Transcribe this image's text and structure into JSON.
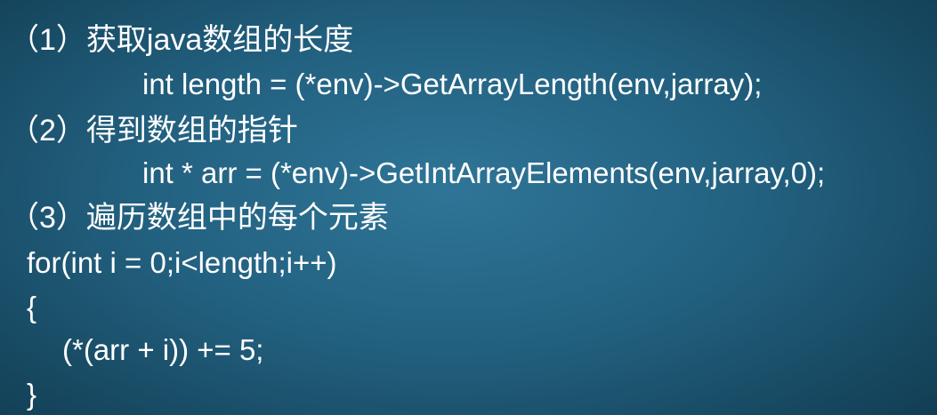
{
  "lines": [
    "（1）获取java数组的长度",
    "int length = (*env)->GetArrayLength(env,jarray);",
    "（2）得到数组的指针",
    "int * arr = (*env)->GetIntArrayElements(env,jarray,0);",
    "（3）遍历数组中的每个元素",
    "for(int i = 0;i<length;i++)",
    "{",
    "(*(arr + i)) += 5;",
    "}"
  ],
  "colors": {
    "background": "#22607f",
    "text": "#ffffff"
  }
}
